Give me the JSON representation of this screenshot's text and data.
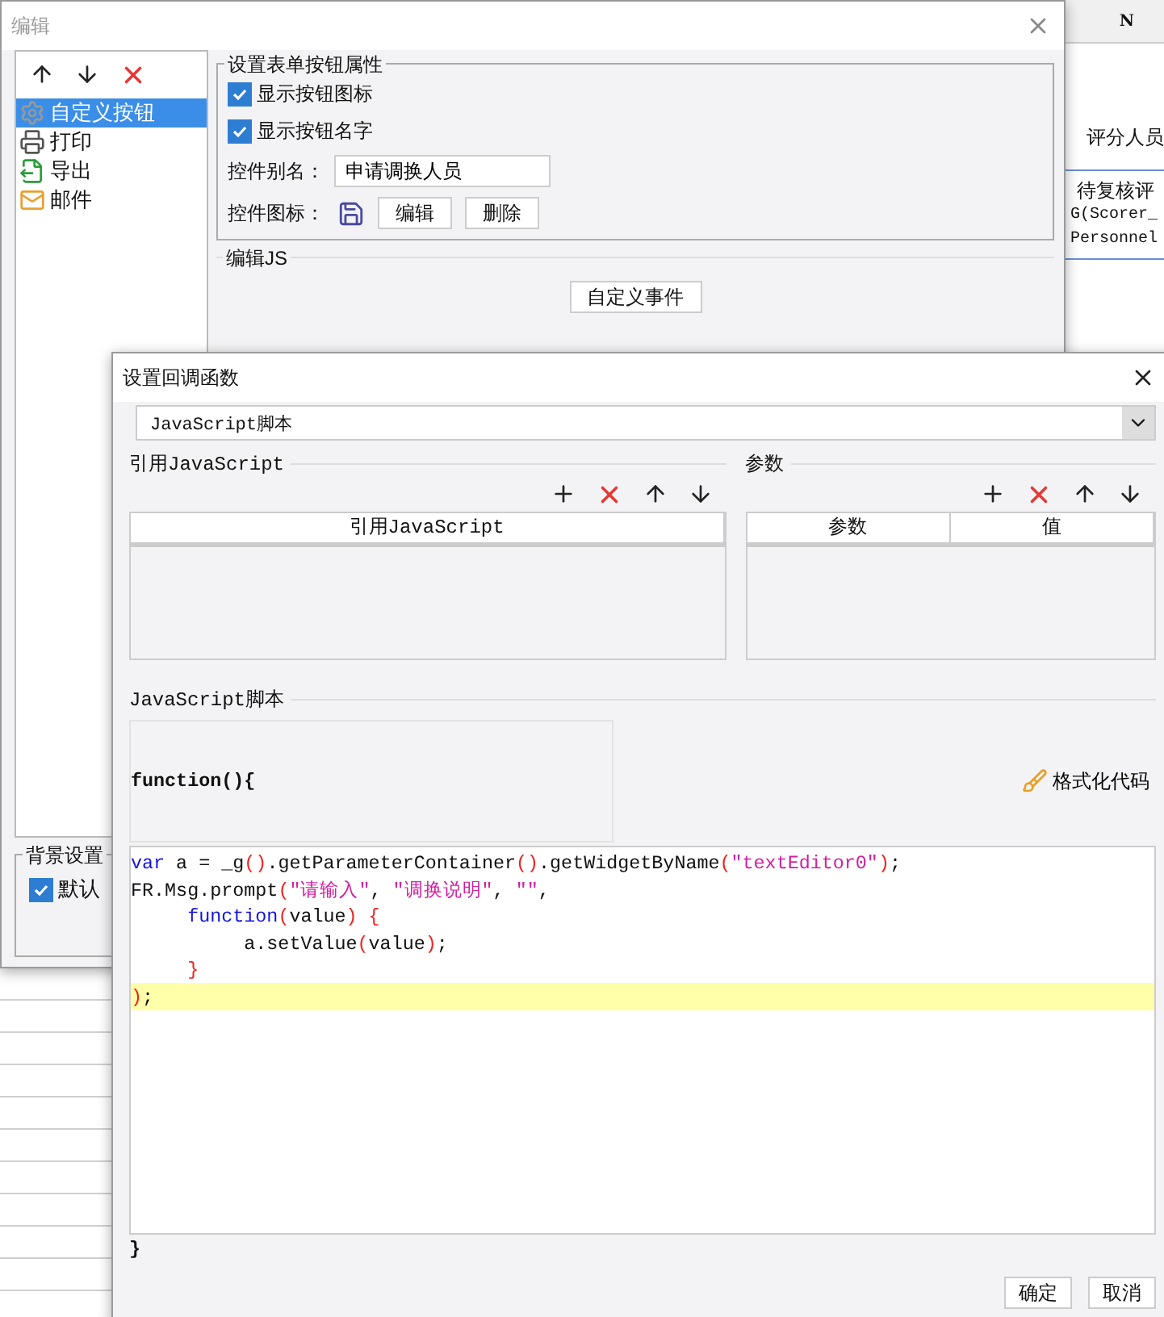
{
  "background_sheet": {
    "column_header": "N",
    "cells": [
      "评分人员",
      "待复核评",
      "G(Scorer_",
      "Personnel"
    ]
  },
  "edit_dialog": {
    "title": "编辑",
    "items": [
      {
        "label": "自定义按钮",
        "kind": "gear",
        "selected": true
      },
      {
        "label": "打印",
        "kind": "printer",
        "selected": false
      },
      {
        "label": "导出",
        "kind": "export",
        "selected": false
      },
      {
        "label": "邮件",
        "kind": "mail",
        "selected": false
      }
    ],
    "button_settings": {
      "title": "设置表单按钮属性",
      "options": [
        {
          "label": "显示按钮图标",
          "checked": true
        },
        {
          "label": "显示按钮名字",
          "checked": true
        }
      ],
      "alias_label": "控件别名：",
      "alias_value": "申请调换人员",
      "icon_label": "控件图标：",
      "buttons": [
        "编辑",
        "删除"
      ]
    },
    "edit_js": {
      "title": "编辑JS",
      "button": "自定义事件"
    },
    "background": {
      "title": "背景设置",
      "option": {
        "label": "默认",
        "checked": true
      }
    }
  },
  "callback_dialog": {
    "title": "设置回调函数",
    "type_select": {
      "value": "JavaScript脚本"
    },
    "referenced_js": {
      "title": "引用JavaScript",
      "columns": [
        "引用JavaScript"
      ]
    },
    "parameters": {
      "title": "参数",
      "columns": [
        "参数",
        "值"
      ]
    },
    "script": {
      "title": "JavaScript脚本",
      "header": "function(){",
      "format_button": "格式化代码",
      "footer": "}",
      "lines": [
        {
          "highlighted": false,
          "tokens": [
            {
              "kind": "keyword",
              "text": "var"
            },
            {
              "kind": "plain",
              "text": " a = _g"
            },
            {
              "kind": "paren",
              "text": "()"
            },
            {
              "kind": "plain",
              "text": ".getParameterContainer"
            },
            {
              "kind": "paren",
              "text": "()"
            },
            {
              "kind": "plain",
              "text": ".getWidgetByName"
            },
            {
              "kind": "paren",
              "text": "("
            },
            {
              "kind": "string",
              "text": "\"textEditor0\""
            },
            {
              "kind": "paren",
              "text": ")"
            },
            {
              "kind": "plain",
              "text": ";"
            }
          ]
        },
        {
          "highlighted": false,
          "tokens": [
            {
              "kind": "plain",
              "text": "FR.Msg.prompt"
            },
            {
              "kind": "paren",
              "text": "("
            },
            {
              "kind": "string",
              "text": "\"请输入\""
            },
            {
              "kind": "plain",
              "text": ", "
            },
            {
              "kind": "string",
              "text": "\"调换说明\""
            },
            {
              "kind": "plain",
              "text": ", "
            },
            {
              "kind": "string",
              "text": "\"\""
            },
            {
              "kind": "plain",
              "text": ","
            }
          ]
        },
        {
          "highlighted": false,
          "tokens": [
            {
              "kind": "keyword",
              "text": "     function"
            },
            {
              "kind": "paren",
              "text": "("
            },
            {
              "kind": "plain",
              "text": "value"
            },
            {
              "kind": "paren",
              "text": ") {"
            }
          ]
        },
        {
          "highlighted": false,
          "tokens": [
            {
              "kind": "plain",
              "text": "          a.setValue"
            },
            {
              "kind": "paren",
              "text": "("
            },
            {
              "kind": "plain",
              "text": "value"
            },
            {
              "kind": "paren",
              "text": ")"
            },
            {
              "kind": "plain",
              "text": ";"
            }
          ]
        },
        {
          "highlighted": false,
          "tokens": [
            {
              "kind": "paren",
              "text": "     }"
            }
          ]
        },
        {
          "highlighted": true,
          "tokens": [
            {
              "kind": "paren",
              "text": ")"
            },
            {
              "kind": "plain",
              "text": ";"
            }
          ]
        }
      ]
    },
    "buttons": [
      "确定",
      "取消"
    ]
  }
}
